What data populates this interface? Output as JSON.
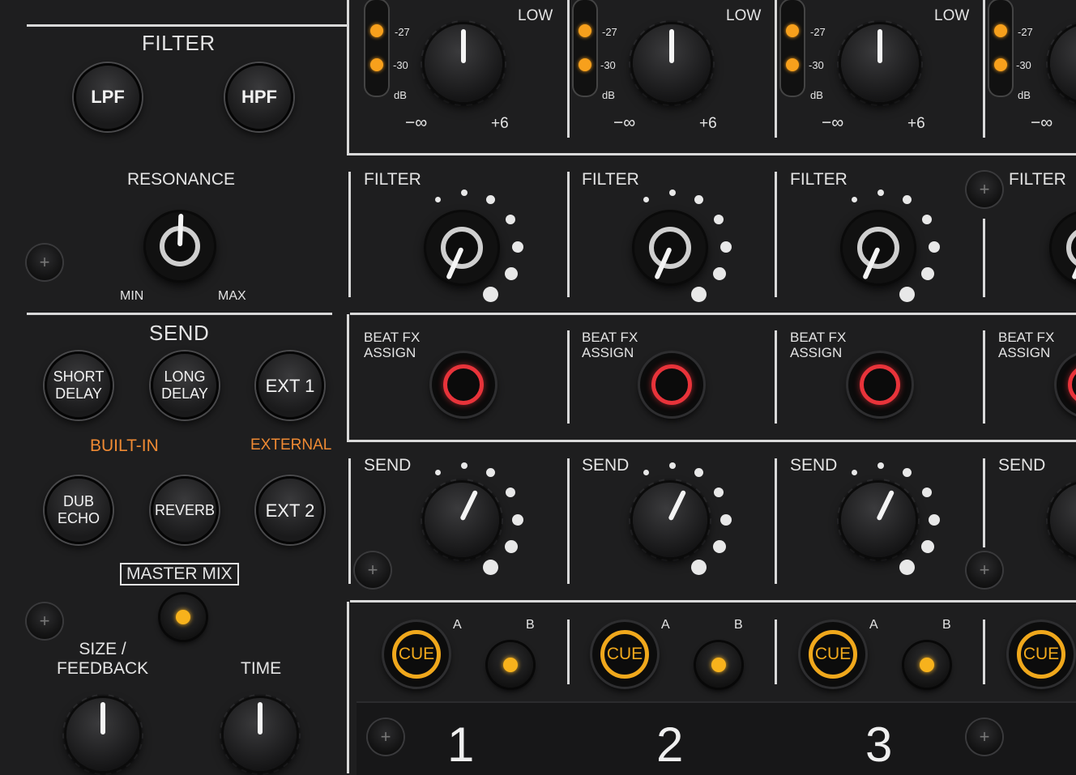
{
  "filter": {
    "title": "FILTER",
    "lpf_label": "LPF",
    "hpf_label": "HPF",
    "resonance_label": "RESONANCE",
    "min_label": "MIN",
    "max_label": "MAX"
  },
  "send": {
    "title": "SEND",
    "short_delay": [
      "SHORT",
      "DELAY"
    ],
    "long_delay": [
      "LONG",
      "DELAY"
    ],
    "ext1": "EXT 1",
    "built_in": "BUILT-IN",
    "external": "EXTERNAL",
    "dub_echo": [
      "DUB",
      "ECHO"
    ],
    "reverb": "REVERB",
    "ext2": "EXT 2",
    "master_mix": "MASTER MIX",
    "size_feedback": [
      "SIZE /",
      "FEEDBACK"
    ],
    "time": "TIME"
  },
  "channels": {
    "eq_label": "LOW",
    "minus_inf": "−∞",
    "plus6": "+6",
    "db": "dB",
    "m27": "-27",
    "m30": "-30",
    "filter_label": "FILTER",
    "beat_fx": [
      "BEAT FX",
      "ASSIGN"
    ],
    "send_label": "SEND",
    "cue_label": "CUE",
    "a_label": "A",
    "b_label": "B",
    "numbers": [
      "1",
      "2",
      "3"
    ]
  },
  "colors": {
    "accent_orange": "#ef8a33",
    "cue_yellow": "#f0a81c",
    "fx_red": "#e8333a"
  }
}
